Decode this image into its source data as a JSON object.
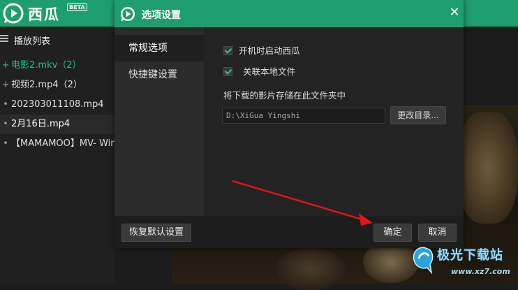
{
  "app": {
    "name": "西瓜",
    "badge": "BETA"
  },
  "playlist": {
    "title": "播放列表",
    "items": [
      {
        "marker": "+",
        "label": "电影2.mkv（2）"
      },
      {
        "marker": "+",
        "label": "视频2.mp4（2）"
      },
      {
        "marker": "•",
        "label": "202303011108.mp4"
      },
      {
        "marker": "•",
        "label": "2月16日.mp4"
      },
      {
        "marker": "•",
        "label": "【MAMAMOO】MV- Win"
      }
    ]
  },
  "dialog": {
    "title": "选项设置",
    "nav": [
      {
        "label": "常规选项"
      },
      {
        "label": "快捷键设置"
      }
    ],
    "options": [
      {
        "label": "开机时启动西瓜",
        "checked": true
      },
      {
        "label": "关联本地文件",
        "checked": true
      }
    ],
    "save_label": "将下载的影片存储在此文件夹中",
    "save_path": "D:\\XiGua Yingshi",
    "change_dir_label": "更改目录...",
    "restore_label": "恢复默认设置",
    "ok_label": "确定",
    "cancel_label": "取消"
  },
  "watermark": {
    "text": "极光下载站",
    "url": "www.xz7.com"
  },
  "colors": {
    "accent": "#1e9e6f",
    "active_item": "#27c08a",
    "check": "#2ec38c",
    "arrow": "#e0141a"
  }
}
